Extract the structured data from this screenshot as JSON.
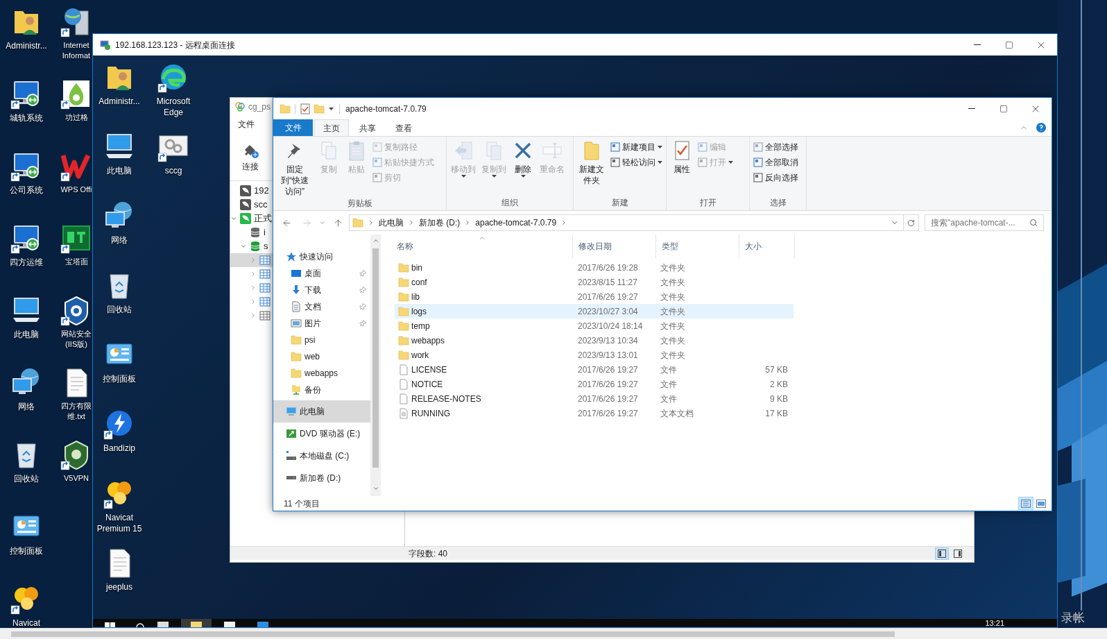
{
  "local_desktop": {
    "column_1": [
      {
        "lines": [
          "Administr..."
        ]
      },
      {
        "lines": [
          "城轨系统"
        ]
      },
      {
        "lines": [
          "公司系统"
        ]
      },
      {
        "lines": [
          "四方运维"
        ]
      },
      {
        "lines": [
          "此电脑"
        ]
      },
      {
        "lines": [
          "网络"
        ]
      },
      {
        "lines": [
          "回收站"
        ]
      },
      {
        "lines": [
          "控制面板"
        ]
      },
      {
        "lines": [
          "Navicat"
        ]
      }
    ],
    "column_2": [
      {
        "lines": [
          "Internet",
          "Informat"
        ]
      },
      {
        "lines": [
          "功过格"
        ]
      },
      {
        "lines": [
          "WPS Offi"
        ]
      },
      {
        "lines": [
          "宝塔面"
        ]
      },
      {
        "lines": [
          "网站安全",
          "(IIS版)"
        ]
      },
      {
        "lines": [
          "四方有限",
          "维.txt"
        ]
      },
      {
        "lines": [
          "V5VPN"
        ]
      }
    ],
    "corner_text": "录帐"
  },
  "remote_window": {
    "title": "192.168.123.123 - 远程桌面连接",
    "desktop": {
      "column_1": [
        {
          "lines": [
            "Administr..."
          ]
        },
        {
          "lines": [
            "此电脑"
          ]
        },
        {
          "lines": [
            "网络"
          ]
        },
        {
          "lines": [
            "回收站"
          ]
        },
        {
          "lines": [
            "控制面板"
          ]
        },
        {
          "lines": [
            "Bandizip"
          ]
        },
        {
          "lines": [
            "Navicat",
            "Premium 15"
          ]
        },
        {
          "lines": [
            "jeeplus"
          ]
        }
      ],
      "column_2": [
        {
          "lines": [
            "Microsoft",
            "Edge"
          ]
        },
        {
          "lines": [
            "sccg"
          ]
        }
      ]
    },
    "navicat": {
      "title": "cg_ps",
      "menu": [
        "文件"
      ],
      "toolbar": [
        {
          "label": "连接"
        }
      ],
      "tree": [
        {
          "label": "192",
          "connected": false,
          "selected": false
        },
        {
          "label": "scc",
          "connected": false,
          "selected": false
        },
        {
          "label": "正式",
          "connected": true,
          "expanded": true,
          "selected": false,
          "children": [
            {
              "label": "i",
              "open": false,
              "selected": false
            },
            {
              "label": "s",
              "open": true,
              "expanded": true,
              "selected": false,
              "children": [
                {
                  "expanded": false,
                  "selected": true
                },
                {
                  "expanded": false,
                  "selected": false
                },
                {
                  "expanded": false,
                  "selected": false
                },
                {
                  "expanded": false,
                  "selected": false
                },
                {
                  "expanded": false,
                  "selected": false
                }
              ]
            }
          ]
        }
      ],
      "status": "字段数: 40",
      "views": [
        {
          "selected": true
        },
        {
          "selected": false
        }
      ]
    },
    "explorer": {
      "title": "apache-tomcat-7.0.79",
      "tabs": [
        {
          "label": "文件",
          "kind": "file",
          "selected": false
        },
        {
          "label": "主页",
          "kind": "tab",
          "selected": true
        },
        {
          "label": "共享",
          "kind": "tab",
          "selected": false
        },
        {
          "label": "查看",
          "kind": "tab",
          "selected": false
        }
      ],
      "ribbon_groups": [
        {
          "label": "剪贴板",
          "buttons": [
            {
              "label": "固定到“快速访问”",
              "kind": "large",
              "disabled": false,
              "dropdown": false
            },
            {
              "label": "复制",
              "kind": "large",
              "disabled": true,
              "dropdown": false
            },
            {
              "label": "粘贴",
              "kind": "large",
              "disabled": true,
              "dropdown": false
            },
            {
              "label": "复制路径",
              "kind": "small",
              "disabled": true,
              "dropdown": false
            },
            {
              "label": "粘贴快捷方式",
              "kind": "small",
              "disabled": true,
              "dropdown": false
            },
            {
              "label": "剪切",
              "kind": "small",
              "disabled": true,
              "dropdown": false
            }
          ]
        },
        {
          "label": "组织",
          "buttons": [
            {
              "label": "移动到",
              "kind": "large",
              "disabled": true,
              "dropdown": true
            },
            {
              "label": "复制到",
              "kind": "large",
              "disabled": true,
              "dropdown": true
            },
            {
              "label": "删除",
              "kind": "large",
              "disabled": false,
              "dropdown": true
            },
            {
              "label": "重命名",
              "kind": "large",
              "disabled": true,
              "dropdown": false
            }
          ]
        },
        {
          "label": "新建",
          "buttons": [
            {
              "label": "新建文件夹",
              "kind": "large",
              "disabled": false,
              "dropdown": false
            },
            {
              "label": "新建项目",
              "kind": "small",
              "disabled": false,
              "dropdown": true
            },
            {
              "label": "轻松访问",
              "kind": "small",
              "disabled": false,
              "dropdown": true
            }
          ]
        },
        {
          "label": "打开",
          "buttons": [
            {
              "label": "属性",
              "kind": "large",
              "disabled": false,
              "dropdown": false
            },
            {
              "label": "编辑",
              "kind": "small",
              "disabled": true,
              "dropdown": false
            },
            {
              "label": "打开",
              "kind": "small",
              "disabled": true,
              "dropdown": true
            }
          ]
        },
        {
          "label": "选择",
          "buttons": [
            {
              "label": "全部选择",
              "kind": "small",
              "disabled": false,
              "dropdown": false
            },
            {
              "label": "全部取消",
              "kind": "small",
              "disabled": false,
              "dropdown": false
            },
            {
              "label": "反向选择",
              "kind": "small",
              "disabled": false,
              "dropdown": false
            }
          ]
        }
      ],
      "breadcrumbs": [
        "此电脑",
        "新加卷 (D:)",
        "apache-tomcat-7.0.79"
      ],
      "search": {
        "placeholder": "搜索\"apache-tomcat-..."
      },
      "nav": [
        {
          "label": "快速访问",
          "selected": false,
          "children": [
            {
              "label": "桌面",
              "pinned": true,
              "selected": false
            },
            {
              "label": "下载",
              "pinned": true,
              "selected": false
            },
            {
              "label": "文档",
              "pinned": true,
              "selected": false
            },
            {
              "label": "图片",
              "pinned": true,
              "selected": false
            },
            {
              "label": "psi",
              "pinned": false,
              "selected": false
            },
            {
              "label": "web",
              "pinned": false,
              "selected": false
            },
            {
              "label": "webapps",
              "pinned": false,
              "selected": false
            },
            {
              "label": "备份",
              "pinned": false,
              "selected": false
            }
          ]
        },
        {
          "label": "此电脑",
          "selected": true,
          "children": [
            {
              "label": "DVD 驱动器 (E:)",
              "selected": false
            },
            {
              "label": "本地磁盘 (C:)",
              "selected": false
            },
            {
              "label": "新加卷 (D:)",
              "selected": false
            }
          ]
        }
      ],
      "columns": [
        {
          "label": "名称",
          "sorted": true
        },
        {
          "label": "修改日期",
          "sorted": false
        },
        {
          "label": "类型",
          "sorted": false
        },
        {
          "label": "大小",
          "sorted": false
        }
      ],
      "files": [
        {
          "name": "bin",
          "date": "2017/6/26 19:28",
          "type": "文件夹",
          "kind": "folder",
          "selected": false
        },
        {
          "name": "conf",
          "date": "2023/8/15 11:27",
          "type": "文件夹",
          "kind": "folder",
          "selected": false
        },
        {
          "name": "lib",
          "date": "2017/6/26 19:27",
          "type": "文件夹",
          "kind": "folder",
          "selected": false
        },
        {
          "name": "logs",
          "date": "2023/10/27 3:04",
          "type": "文件夹",
          "kind": "folder",
          "selected": true
        },
        {
          "name": "temp",
          "date": "2023/10/24 18:14",
          "type": "文件夹",
          "kind": "folder",
          "selected": false
        },
        {
          "name": "webapps",
          "date": "2023/9/13 10:34",
          "type": "文件夹",
          "kind": "folder",
          "selected": false
        },
        {
          "name": "work",
          "date": "2023/9/13 13:01",
          "type": "文件夹",
          "kind": "folder",
          "selected": false
        },
        {
          "name": "LICENSE",
          "date": "2017/6/26 19:27",
          "type": "文件",
          "size": "57 KB",
          "kind": "file",
          "selected": false
        },
        {
          "name": "NOTICE",
          "date": "2017/6/26 19:27",
          "type": "文件",
          "size": "2 KB",
          "kind": "file",
          "selected": false
        },
        {
          "name": "RELEASE-NOTES",
          "date": "2017/6/26 19:27",
          "type": "文件",
          "size": "9 KB",
          "kind": "file",
          "selected": false
        },
        {
          "name": "RUNNING",
          "date": "2017/6/26 19:27",
          "type": "文本文档",
          "size": "17 KB",
          "kind": "text",
          "selected": false
        }
      ],
      "status": "11 个项目",
      "views": [
        {
          "selected": true
        },
        {
          "selected": false
        }
      ]
    },
    "taskbar": {
      "apps": [
        {
          "active": false
        },
        {
          "active": true
        },
        {
          "active": false
        },
        {
          "active": false
        }
      ],
      "clock": "13:21"
    }
  }
}
